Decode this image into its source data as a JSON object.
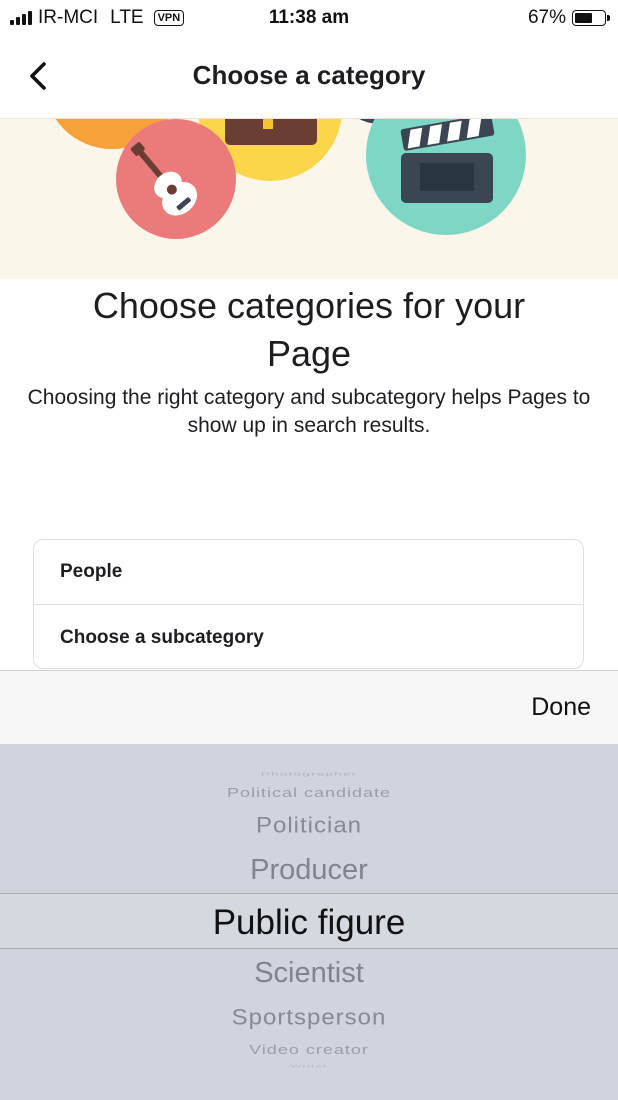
{
  "status_bar": {
    "carrier": "IR-MCI",
    "network": "LTE",
    "vpn": "VPN",
    "time": "11:38 am",
    "battery_text": "67%",
    "battery_level": 0.67
  },
  "nav": {
    "title": "Choose a category"
  },
  "hero": {
    "colors": {
      "background": "#fbf6ea",
      "orange": "#f6a13a",
      "red": "#ea7b7a",
      "yellow": "#fbd54a",
      "teal": "#7ed6c5",
      "brown": "#6a3e32",
      "clapper": "#3a4653"
    },
    "icons": [
      "guitar-icon",
      "briefcase-icon",
      "clapperboard-icon"
    ]
  },
  "main": {
    "heading": "Choose categories for your Page",
    "subtext": "Choosing the right category and subcategory helps Pages to show up in search results."
  },
  "form": {
    "category_value": "People",
    "subcategory_value": "Choose a subcategory"
  },
  "picker": {
    "done_label": "Done",
    "items": [
      "Photographer",
      "Political candidate",
      "Politician",
      "Producer",
      "Public figure",
      "Scientist",
      "Sportsperson",
      "Video creator",
      "Writer"
    ],
    "selected": "Public figure"
  }
}
